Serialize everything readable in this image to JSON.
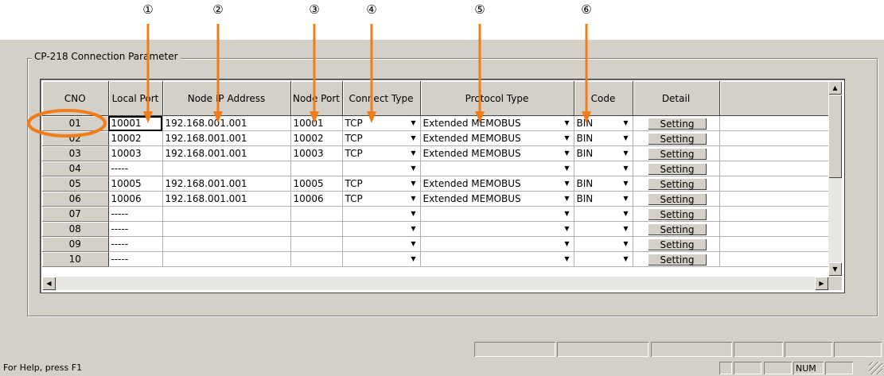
{
  "callouts": [
    "①",
    "②",
    "③",
    "④",
    "⑤",
    "⑥"
  ],
  "accent_color": "#f07d1a",
  "group_title": "CP-218 Connection Parameter",
  "columns": [
    "CNO",
    "Local Port",
    "Node IP Address",
    "Node Port",
    "Connect Type",
    "Protocol Type",
    "Code",
    "Detail"
  ],
  "rows": [
    {
      "cno": "01",
      "local_port": "10001",
      "ip": "192.168.001.001",
      "node_port": "10001",
      "connect": "TCP",
      "protocol": "Extended MEMOBUS",
      "code": "BIN",
      "detail": "Setting"
    },
    {
      "cno": "02",
      "local_port": "10002",
      "ip": "192.168.001.001",
      "node_port": "10002",
      "connect": "TCP",
      "protocol": "Extended MEMOBUS",
      "code": "BIN",
      "detail": "Setting"
    },
    {
      "cno": "03",
      "local_port": "10003",
      "ip": "192.168.001.001",
      "node_port": "10003",
      "connect": "TCP",
      "protocol": "Extended MEMOBUS",
      "code": "BIN",
      "detail": "Setting"
    },
    {
      "cno": "04",
      "local_port": "-----",
      "ip": "",
      "node_port": "",
      "connect": "",
      "protocol": "",
      "code": "",
      "detail": "Setting"
    },
    {
      "cno": "05",
      "local_port": "10005",
      "ip": "192.168.001.001",
      "node_port": "10005",
      "connect": "TCP",
      "protocol": "Extended MEMOBUS",
      "code": "BIN",
      "detail": "Setting"
    },
    {
      "cno": "06",
      "local_port": "10006",
      "ip": "192.168.001.001",
      "node_port": "10006",
      "connect": "TCP",
      "protocol": "Extended MEMOBUS",
      "code": "BIN",
      "detail": "Setting"
    },
    {
      "cno": "07",
      "local_port": "-----",
      "ip": "",
      "node_port": "",
      "connect": "",
      "protocol": "",
      "code": "",
      "detail": "Setting"
    },
    {
      "cno": "08",
      "local_port": "-----",
      "ip": "",
      "node_port": "",
      "connect": "",
      "protocol": "",
      "code": "",
      "detail": "Setting"
    },
    {
      "cno": "09",
      "local_port": "-----",
      "ip": "",
      "node_port": "",
      "connect": "",
      "protocol": "",
      "code": "",
      "detail": "Setting"
    },
    {
      "cno": "10",
      "local_port": "-----",
      "ip": "",
      "node_port": "",
      "connect": "",
      "protocol": "",
      "code": "",
      "detail": "Setting"
    }
  ],
  "icons": {
    "dropdown": "triangle-down-icon",
    "scroll_up": "arrow-up-icon",
    "scroll_down": "arrow-down-icon",
    "scroll_left": "arrow-left-icon",
    "scroll_right": "arrow-right-icon"
  },
  "status": {
    "help": "For Help, press F1",
    "num": "NUM"
  }
}
